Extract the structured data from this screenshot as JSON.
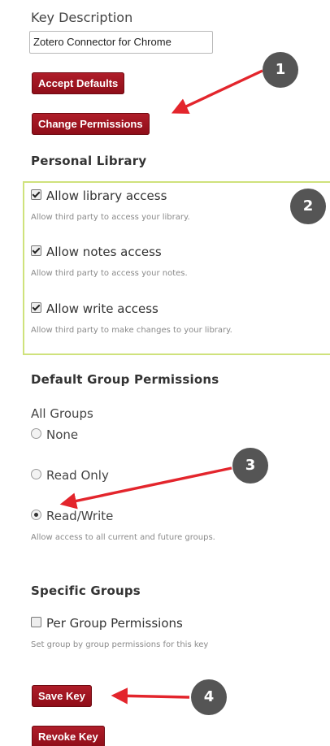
{
  "form": {
    "key_description_label": "Key Description",
    "key_description_value": "Zotero Connector for Chrome"
  },
  "buttons": {
    "accept_defaults": "Accept Defaults",
    "change_permissions": "Change Permissions",
    "save_key": "Save Key",
    "revoke_key": "Revoke Key"
  },
  "personal_library": {
    "title": "Personal Library",
    "items": [
      {
        "label": "Allow library access",
        "help": "Allow third party to access your library.",
        "checked": true
      },
      {
        "label": "Allow notes access",
        "help": "Allow third party to access your notes.",
        "checked": true
      },
      {
        "label": "Allow write access",
        "help": "Allow third party to make changes to your library.",
        "checked": true
      }
    ]
  },
  "default_group_permissions": {
    "title": "Default Group Permissions",
    "group_label": "All Groups",
    "options": [
      {
        "label": "None",
        "selected": false
      },
      {
        "label": "Read Only",
        "selected": false
      },
      {
        "label": "Read/Write",
        "selected": true
      }
    ],
    "help": "Allow access to all current and future groups."
  },
  "specific_groups": {
    "title": "Specific Groups",
    "checkbox_label": "Per Group Permissions",
    "checked": false,
    "help": "Set group by group permissions for this key"
  },
  "annotations": {
    "badges": [
      "1",
      "2",
      "3",
      "4"
    ],
    "arrow_color": "#e3252c",
    "badge_color": "#555555"
  }
}
